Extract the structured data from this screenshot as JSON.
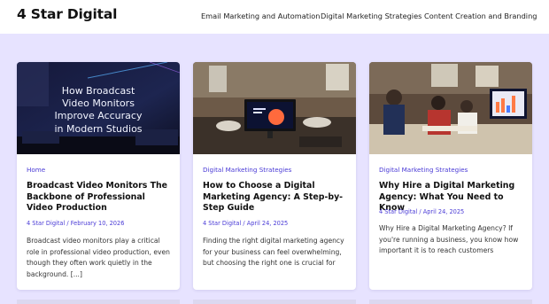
{
  "site": {
    "title": "4 Star Digital"
  },
  "nav": {
    "items": [
      {
        "label": "Email Marketing and Automation"
      },
      {
        "label": "Digital Marketing Strategies"
      },
      {
        "label": "Content Creation and Branding"
      }
    ]
  },
  "posts": [
    {
      "image_text": [
        "How Broadcast",
        "Video Monitors",
        "Improve Accuracy",
        "in Modern Studios"
      ],
      "category": "Home",
      "title": "Broadcast Video Monitors The Backbone of Professional Video Production",
      "meta": "4 Star Digital / February 10, 2026",
      "excerpt": "Broadcast video monitors play a critical role in professional video production, even though they often work quietly in the background. [...]"
    },
    {
      "category": "Digital Marketing Strategies",
      "title": "How to Choose a Digital Marketing Agency: A Step-by-Step Guide",
      "meta": "4 Star Digital / April 24, 2025",
      "excerpt": "Finding the right digital marketing agency for your business can feel overwhelming, but choosing the right one is crucial for"
    },
    {
      "category": "Digital Marketing Strategies",
      "title": "Why Hire a Digital Marketing Agency: What You Need to Know",
      "meta": "4 Star Digital / April 24, 2025",
      "excerpt": "Why Hire a Digital Marketing Agency? If you're running a business, you know how important it is to reach customers"
    }
  ],
  "colors": {
    "page_background": "#e7e3ff",
    "accent": "#4a3bd6",
    "card": "#ffffff"
  }
}
